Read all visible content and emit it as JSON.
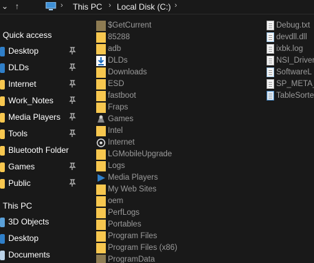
{
  "address_bar": {
    "breadcrumbs": [
      "This PC",
      "Local Disk (C:)"
    ]
  },
  "nav_pane": {
    "quick_access_label": "Quick access",
    "quick_access": [
      {
        "label": "Desktop",
        "icon": "desktop-icon"
      },
      {
        "label": "DLDs",
        "icon": "download-folder-icon"
      },
      {
        "label": "Internet",
        "icon": "folder-icon"
      },
      {
        "label": "Work_Notes",
        "icon": "folder-icon"
      },
      {
        "label": "Media Players",
        "icon": "folder-icon"
      },
      {
        "label": "Tools",
        "icon": "folder-icon"
      },
      {
        "label": "Bluetooth Folder",
        "icon": "folder-icon"
      },
      {
        "label": "Games",
        "icon": "folder-icon"
      },
      {
        "label": "Public",
        "icon": "folder-icon"
      }
    ],
    "this_pc_label": "This PC",
    "this_pc": [
      {
        "label": "3D Objects",
        "icon": "3d-objects-icon"
      },
      {
        "label": "Desktop",
        "icon": "desktop-icon"
      },
      {
        "label": "Documents",
        "icon": "documents-icon"
      }
    ]
  },
  "files_col1": [
    {
      "name": "$GetCurrent",
      "icon": "folder-dim-icon"
    },
    {
      "name": "85288",
      "icon": "folder-icon"
    },
    {
      "name": "adb",
      "icon": "folder-icon"
    },
    {
      "name": "DLDs",
      "icon": "download-folder-icon"
    },
    {
      "name": "Downloads",
      "icon": "folder-icon"
    },
    {
      "name": "ESD",
      "icon": "folder-icon"
    },
    {
      "name": "fastboot",
      "icon": "folder-icon"
    },
    {
      "name": "Fraps",
      "icon": "folder-icon"
    },
    {
      "name": "Games",
      "icon": "games-folder-icon"
    },
    {
      "name": "Intel",
      "icon": "folder-icon"
    },
    {
      "name": "Internet",
      "icon": "internet-folder-icon"
    },
    {
      "name": "LGMobileUpgrade",
      "icon": "folder-icon"
    },
    {
      "name": "Logs",
      "icon": "folder-icon"
    },
    {
      "name": "Media Players",
      "icon": "media-folder-icon"
    },
    {
      "name": "My Web Sites",
      "icon": "folder-icon"
    },
    {
      "name": "oem",
      "icon": "folder-icon"
    },
    {
      "name": "PerfLogs",
      "icon": "folder-icon"
    },
    {
      "name": "Portables",
      "icon": "folder-icon"
    },
    {
      "name": "Program Files",
      "icon": "folder-icon"
    },
    {
      "name": "Program Files (x86)",
      "icon": "folder-icon"
    },
    {
      "name": "ProgramData",
      "icon": "folder-dim-icon"
    }
  ],
  "files_col2": [
    {
      "name": "Debug.txt",
      "icon": "text-file-icon"
    },
    {
      "name": "devdll.dll",
      "icon": "dll-file-icon"
    },
    {
      "name": "ixbk.log",
      "icon": "text-file-icon"
    },
    {
      "name": "NSI_Driver",
      "icon": "text-file-icon"
    },
    {
      "name": "SoftwareL",
      "icon": "settings-file-icon"
    },
    {
      "name": "SP_META_",
      "icon": "text-file-icon"
    },
    {
      "name": "TableSorte",
      "icon": "blue-file-icon"
    }
  ],
  "colors": {
    "background": "#191919",
    "folder": "#f7c74f",
    "text": "#ffffff",
    "file_text": "#9a9a9a"
  }
}
